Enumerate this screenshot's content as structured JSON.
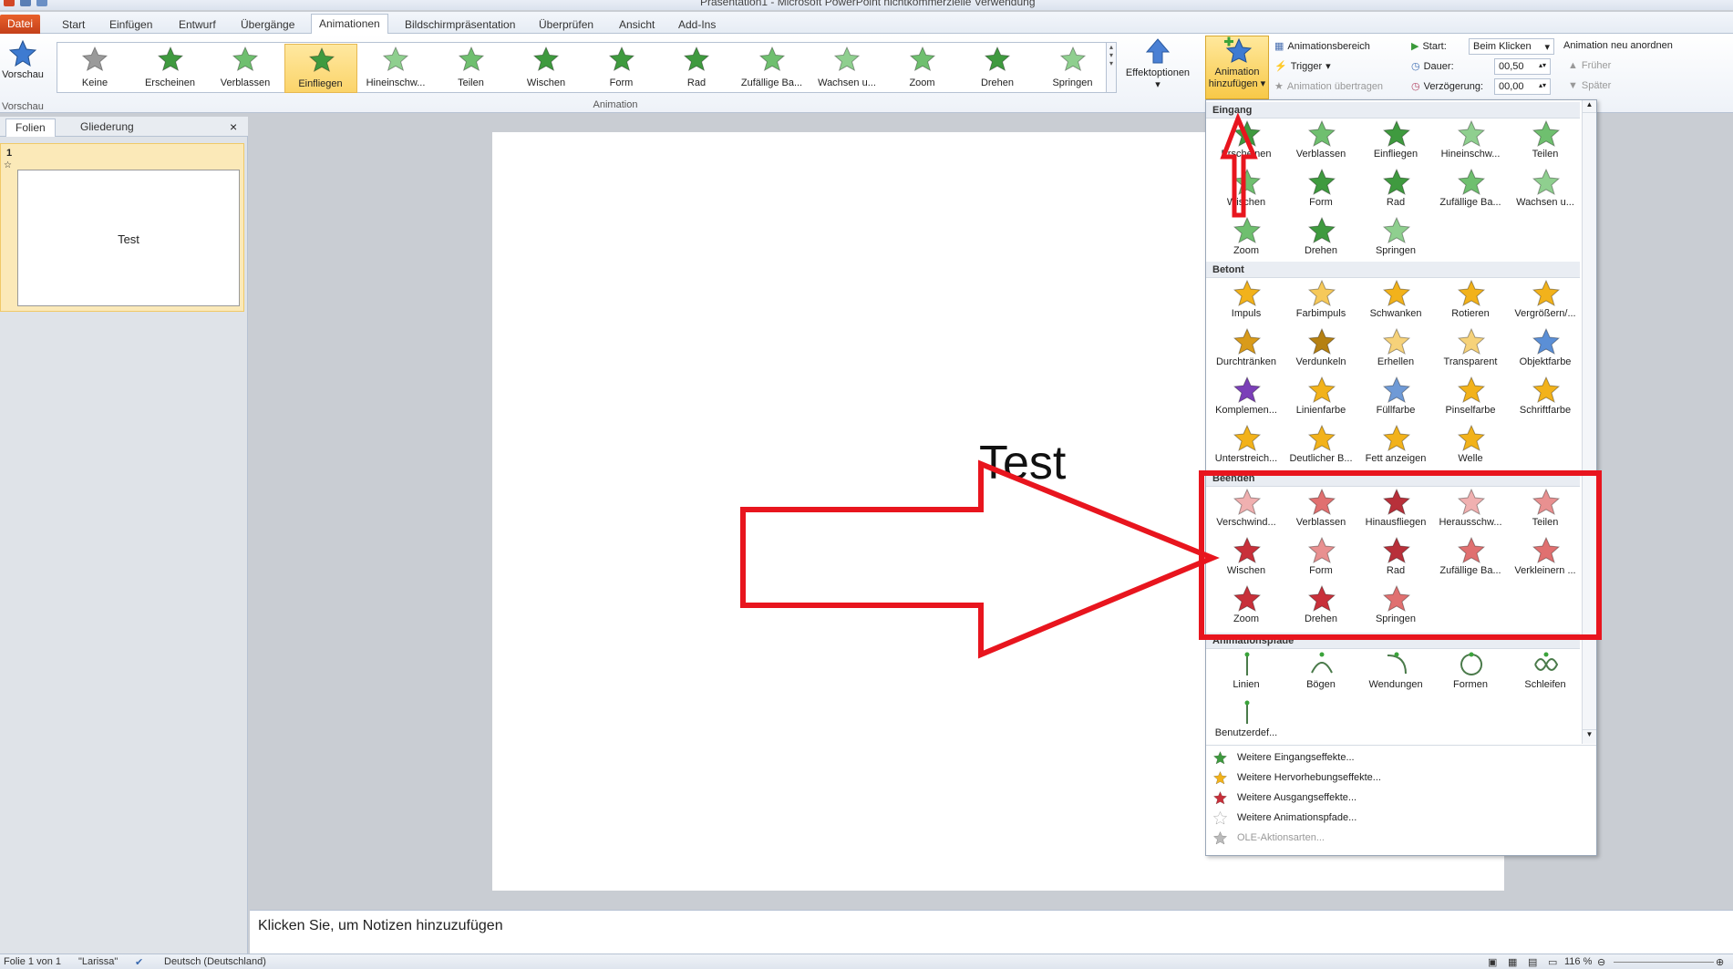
{
  "window": {
    "title": "Präsentation1 - Microsoft PowerPoint nichtkommerzielle Verwendung"
  },
  "tabs": [
    {
      "label": "Datei"
    },
    {
      "label": "Start"
    },
    {
      "label": "Einfügen"
    },
    {
      "label": "Entwurf"
    },
    {
      "label": "Übergänge"
    },
    {
      "label": "Animationen"
    },
    {
      "label": "Bildschirmpräsentation"
    },
    {
      "label": "Überprüfen"
    },
    {
      "label": "Ansicht"
    },
    {
      "label": "Add-Ins"
    }
  ],
  "ribbon": {
    "preview": {
      "label": "Vorschau",
      "group": "Vorschau"
    },
    "animation_group": "Animation",
    "gallery": [
      {
        "label": "Keine",
        "color": "#9a9a9a"
      },
      {
        "label": "Erscheinen",
        "color": "#3f9a3f"
      },
      {
        "label": "Verblassen",
        "color": "#6fbf6f"
      },
      {
        "label": "Einfliegen",
        "color": "#3f9a3f"
      },
      {
        "label": "Hineinschw...",
        "color": "#8fcf8f"
      },
      {
        "label": "Teilen",
        "color": "#6fbf6f"
      },
      {
        "label": "Wischen",
        "color": "#3f9a3f"
      },
      {
        "label": "Form",
        "color": "#3f9a3f"
      },
      {
        "label": "Rad",
        "color": "#3f9a3f"
      },
      {
        "label": "Zufällige Ba...",
        "color": "#6fbf6f"
      },
      {
        "label": "Wachsen u...",
        "color": "#8fcf8f"
      },
      {
        "label": "Zoom",
        "color": "#6fbf6f"
      },
      {
        "label": "Drehen",
        "color": "#3f9a3f"
      },
      {
        "label": "Springen",
        "color": "#8fcf8f"
      }
    ],
    "effect_options": "Effektoptionen",
    "add_animation_line1": "Animation",
    "add_animation_line2": "hinzufügen",
    "animation_pane": "Animationsbereich",
    "trigger": "Trigger",
    "animation_painter": "Animation übertragen",
    "start_label": "Start:",
    "start_value": "Beim Klicken",
    "duration_label": "Dauer:",
    "duration_value": "00,50",
    "delay_label": "Verzögerung:",
    "delay_value": "00,00",
    "reorder": "Animation neu anordnen",
    "earlier": "Früher",
    "later": "Später"
  },
  "left_panel": {
    "tab_slides": "Folien",
    "tab_outline": "Gliederung",
    "slide_number": "1",
    "thumb_text": "Test"
  },
  "slide": {
    "title": "Test"
  },
  "notes": {
    "placeholder": "Klicken Sie, um Notizen hinzuzufügen"
  },
  "status": {
    "slide_info": "Folie 1 von 1",
    "theme": "\"Larissa\"",
    "language": "Deutsch (Deutschland)",
    "zoom": "116 %"
  },
  "dropdown": {
    "sections": {
      "entrance": "Eingang",
      "emphasis": "Betont",
      "exit": "Beenden",
      "paths": "Animationspfade"
    },
    "entrance": [
      {
        "label": "Erscheinen",
        "color": "#3f9a3f"
      },
      {
        "label": "Verblassen",
        "color": "#6fbf6f"
      },
      {
        "label": "Einfliegen",
        "color": "#3f9a3f"
      },
      {
        "label": "Hineinschw...",
        "color": "#8fcf8f"
      },
      {
        "label": "Teilen",
        "color": "#6fbf6f"
      },
      {
        "label": "Wischen",
        "color": "#6fbf6f"
      },
      {
        "label": "Form",
        "color": "#3f9a3f"
      },
      {
        "label": "Rad",
        "color": "#3f9a3f"
      },
      {
        "label": "Zufällige Ba...",
        "color": "#6fbf6f"
      },
      {
        "label": "Wachsen u...",
        "color": "#8fcf8f"
      },
      {
        "label": "Zoom",
        "color": "#6fbf6f"
      },
      {
        "label": "Drehen",
        "color": "#3f9a3f"
      },
      {
        "label": "Springen",
        "color": "#8fcf8f"
      }
    ],
    "emphasis": [
      {
        "label": "Impuls",
        "color": "#f2b21b"
      },
      {
        "label": "Farbimpuls",
        "color": "#f6c95a"
      },
      {
        "label": "Schwanken",
        "color": "#f2b21b"
      },
      {
        "label": "Rotieren",
        "color": "#f2b21b"
      },
      {
        "label": "Vergrößern/...",
        "color": "#f2b21b"
      },
      {
        "label": "Durchtränken",
        "color": "#d99b1a"
      },
      {
        "label": "Verdunkeln",
        "color": "#b58012"
      },
      {
        "label": "Erhellen",
        "color": "#f6d27a"
      },
      {
        "label": "Transparent",
        "color": "#f6d27a"
      },
      {
        "label": "Objektfarbe",
        "color": "#5b8fd6"
      },
      {
        "label": "Komplemen...",
        "color": "#7b3fb8"
      },
      {
        "label": "Linienfarbe",
        "color": "#f2b21b"
      },
      {
        "label": "Füllfarbe",
        "color": "#6f9ad6"
      },
      {
        "label": "Pinselfarbe",
        "color": "#f2b21b"
      },
      {
        "label": "Schriftfarbe",
        "color": "#f2b21b"
      },
      {
        "label": "Unterstreich...",
        "color": "#f2b21b"
      },
      {
        "label": "Deutlicher B...",
        "color": "#f2b21b"
      },
      {
        "label": "Fett anzeigen",
        "color": "#f2b21b"
      },
      {
        "label": "Welle",
        "color": "#f2b21b"
      }
    ],
    "exit": [
      {
        "label": "Verschwind...",
        "color": "#f0b0b0"
      },
      {
        "label": "Verblassen",
        "color": "#e07070"
      },
      {
        "label": "Hinausfliegen",
        "color": "#b8303a"
      },
      {
        "label": "Herausschw...",
        "color": "#f0b0b0"
      },
      {
        "label": "Teilen",
        "color": "#e89090"
      },
      {
        "label": "Wischen",
        "color": "#c8303a"
      },
      {
        "label": "Form",
        "color": "#e89090"
      },
      {
        "label": "Rad",
        "color": "#b8303a"
      },
      {
        "label": "Zufällige Ba...",
        "color": "#e07070"
      },
      {
        "label": "Verkleinern ...",
        "color": "#e07070"
      },
      {
        "label": "Zoom",
        "color": "#c8303a"
      },
      {
        "label": "Drehen",
        "color": "#c8303a"
      },
      {
        "label": "Springen",
        "color": "#e07070"
      }
    ],
    "paths": [
      {
        "label": "Linien"
      },
      {
        "label": "Bögen"
      },
      {
        "label": "Wendungen"
      },
      {
        "label": "Formen"
      },
      {
        "label": "Schleifen"
      },
      {
        "label": "Benutzerdef..."
      }
    ],
    "more": [
      {
        "label": "Weitere Eingangseffekte...",
        "color": "#3f9a3f"
      },
      {
        "label": "Weitere Hervorhebungseffekte...",
        "color": "#f2b21b"
      },
      {
        "label": "Weitere Ausgangseffekte...",
        "color": "#c8303a"
      },
      {
        "label": "Weitere Animationspfade...",
        "color": "#ffffff"
      },
      {
        "label": "OLE-Aktionsarten...",
        "color": "#bbbbbb"
      }
    ]
  },
  "annotation_color": "#e8151e"
}
